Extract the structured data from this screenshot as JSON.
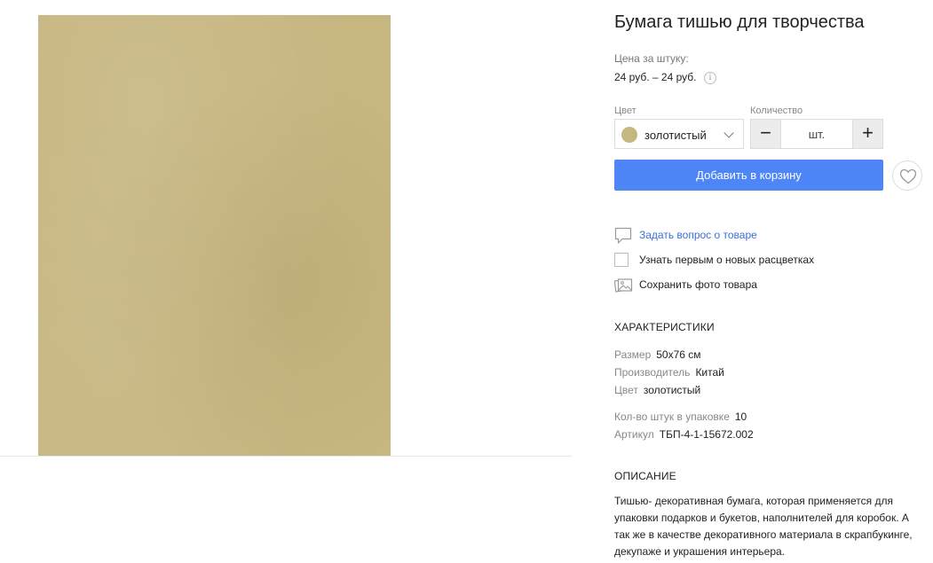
{
  "product": {
    "title": "Бумага тишью для творчества",
    "price_label": "Цена за штуку:",
    "price_value": "24 руб. – 24 руб.",
    "info_glyph": "i"
  },
  "options": {
    "color_label": "Цвет",
    "color_value": "золотистый",
    "color_swatch": "#c6b680",
    "quantity_label": "Количество",
    "quantity_value": "",
    "quantity_placeholder": "шт.",
    "minus_glyph": "−",
    "plus_glyph": "+"
  },
  "actions": {
    "add_to_cart": "Добавить в корзину",
    "ask_question": "Задать вопрос о товаре",
    "notify_new_colors": "Узнать первым о новых расцветках",
    "save_photo": "Сохранить фото товара"
  },
  "characteristics": {
    "heading": "ХАРАКТЕРИСТИКИ",
    "rows": [
      {
        "label": "Размер",
        "value": "50х76 см"
      },
      {
        "label": "Производитель",
        "value": "Китай"
      },
      {
        "label": "Цвет",
        "value": "золотистый"
      },
      {
        "label": "Кол-во штук в упаковке",
        "value": "10"
      },
      {
        "label": "Артикул",
        "value": "ТБП-4-1-15672.002"
      }
    ]
  },
  "description": {
    "heading": "ОПИСАНИЕ",
    "text": "Тишью- декоративная бумага, которая применяется для упаковки подарков и букетов, наполнителей для коробок. А так же в качестве декоративного материала в скрапбукинге, декупаже и украшения интерьера."
  },
  "icons": {
    "chat": "chat-bubble-icon",
    "checkbox": "checkbox-icon",
    "photo": "image-icon",
    "heart": "heart-icon",
    "chevron": "chevron-down-icon",
    "info": "info-icon"
  },
  "colors": {
    "accent": "#4f86f7",
    "link": "#3b6fd8",
    "product_gold": "#c6b680"
  }
}
